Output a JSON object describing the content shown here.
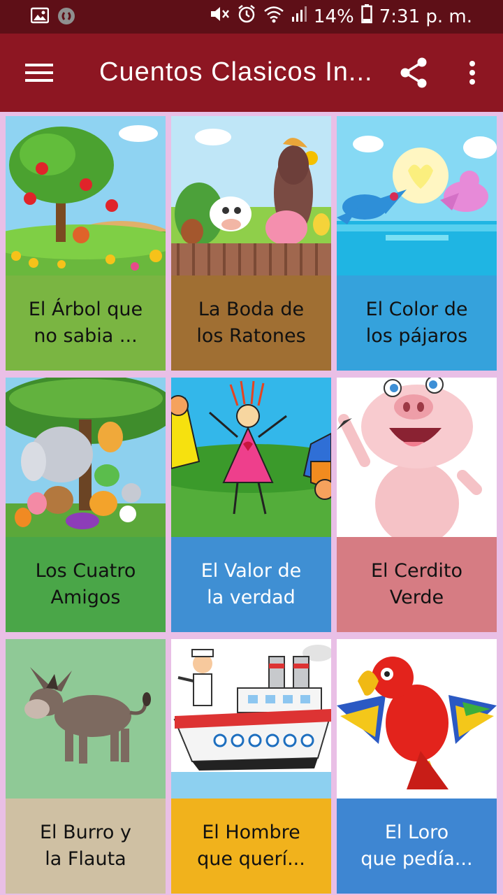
{
  "status_bar": {
    "battery": "14%",
    "time": "7:31 p. m."
  },
  "app_bar": {
    "title": "Cuentos Clasicos In...",
    "menu_icon": "hamburger-menu-icon",
    "share_icon": "share-icon",
    "more_icon": "more-vert-icon"
  },
  "stories": [
    {
      "title": "El Árbol que\nno sabia ...",
      "caption_color": "#7ab542",
      "text": "dark"
    },
    {
      "title": "La Boda de\nlos Ratones",
      "caption_color": "#a06f33",
      "text": "light"
    },
    {
      "title": "El Color de\nlos pájaros",
      "caption_color": "#35a2dc",
      "text": "dark"
    },
    {
      "title": "Los Cuatro\nAmigos",
      "caption_color": "#4aa648",
      "text": "dark"
    },
    {
      "title": "El Valor de\nla verdad",
      "caption_color": "#3f8fd3",
      "text": "light"
    },
    {
      "title": "El Cerdito\nVerde",
      "caption_color": "#d67c83",
      "text": "dark"
    },
    {
      "title": "El Burro y\nla Flauta",
      "caption_color": "#cfc0a3",
      "text": "dark"
    },
    {
      "title": "El Hombre\nque querí...",
      "caption_color": "#f1b21c",
      "text": "dark"
    },
    {
      "title": "El Loro\nque pedía...",
      "caption_color": "#3e86d2",
      "text": "light"
    }
  ]
}
